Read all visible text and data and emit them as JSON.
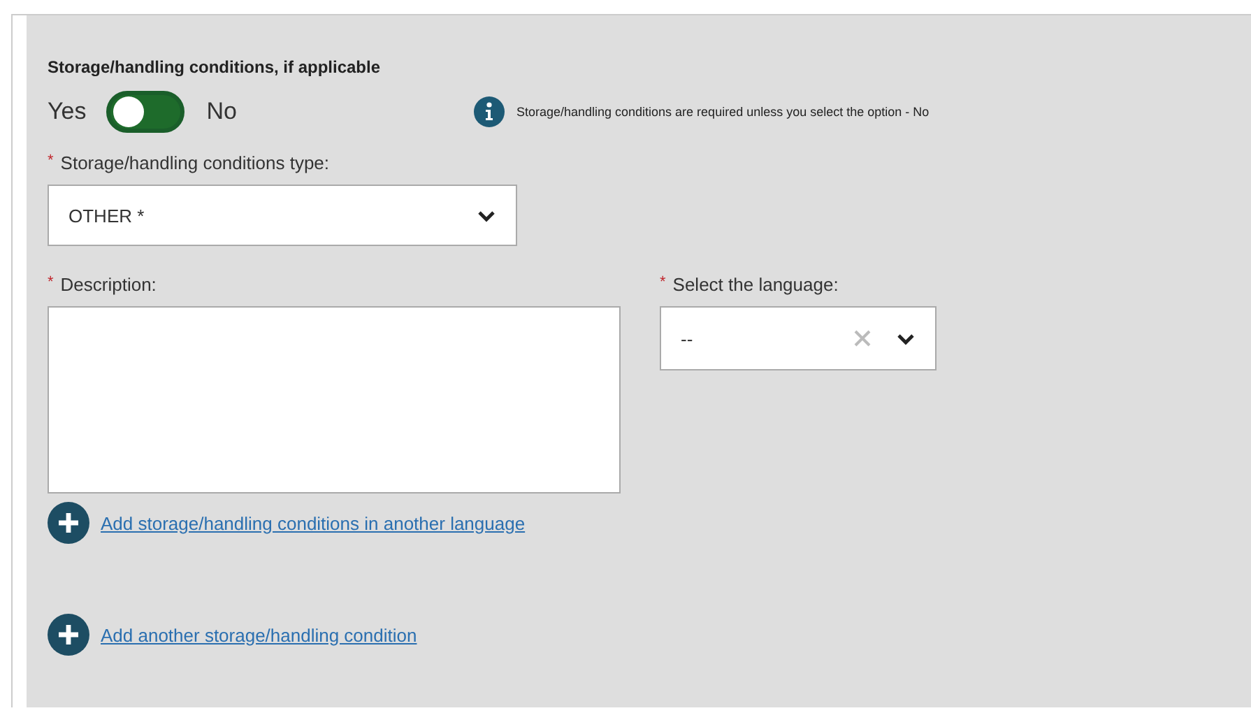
{
  "section": {
    "title": "Storage/handling conditions, if applicable",
    "toggle": {
      "left_label": "Yes",
      "right_label": "No",
      "no_selected": false
    },
    "info": "Storage/handling conditions are required unless you select the option - No",
    "type_field": {
      "marker": "*",
      "label": "Storage/handling conditions type:",
      "value": "OTHER *"
    },
    "description_field": {
      "marker": "*",
      "label": "Description:"
    },
    "language_field": {
      "marker": "*",
      "label": "Select the language:",
      "value": "--"
    },
    "links": [
      {
        "label": "Add storage/handling conditions in another language"
      },
      {
        "label": "Add another storage/handling condition"
      }
    ]
  }
}
